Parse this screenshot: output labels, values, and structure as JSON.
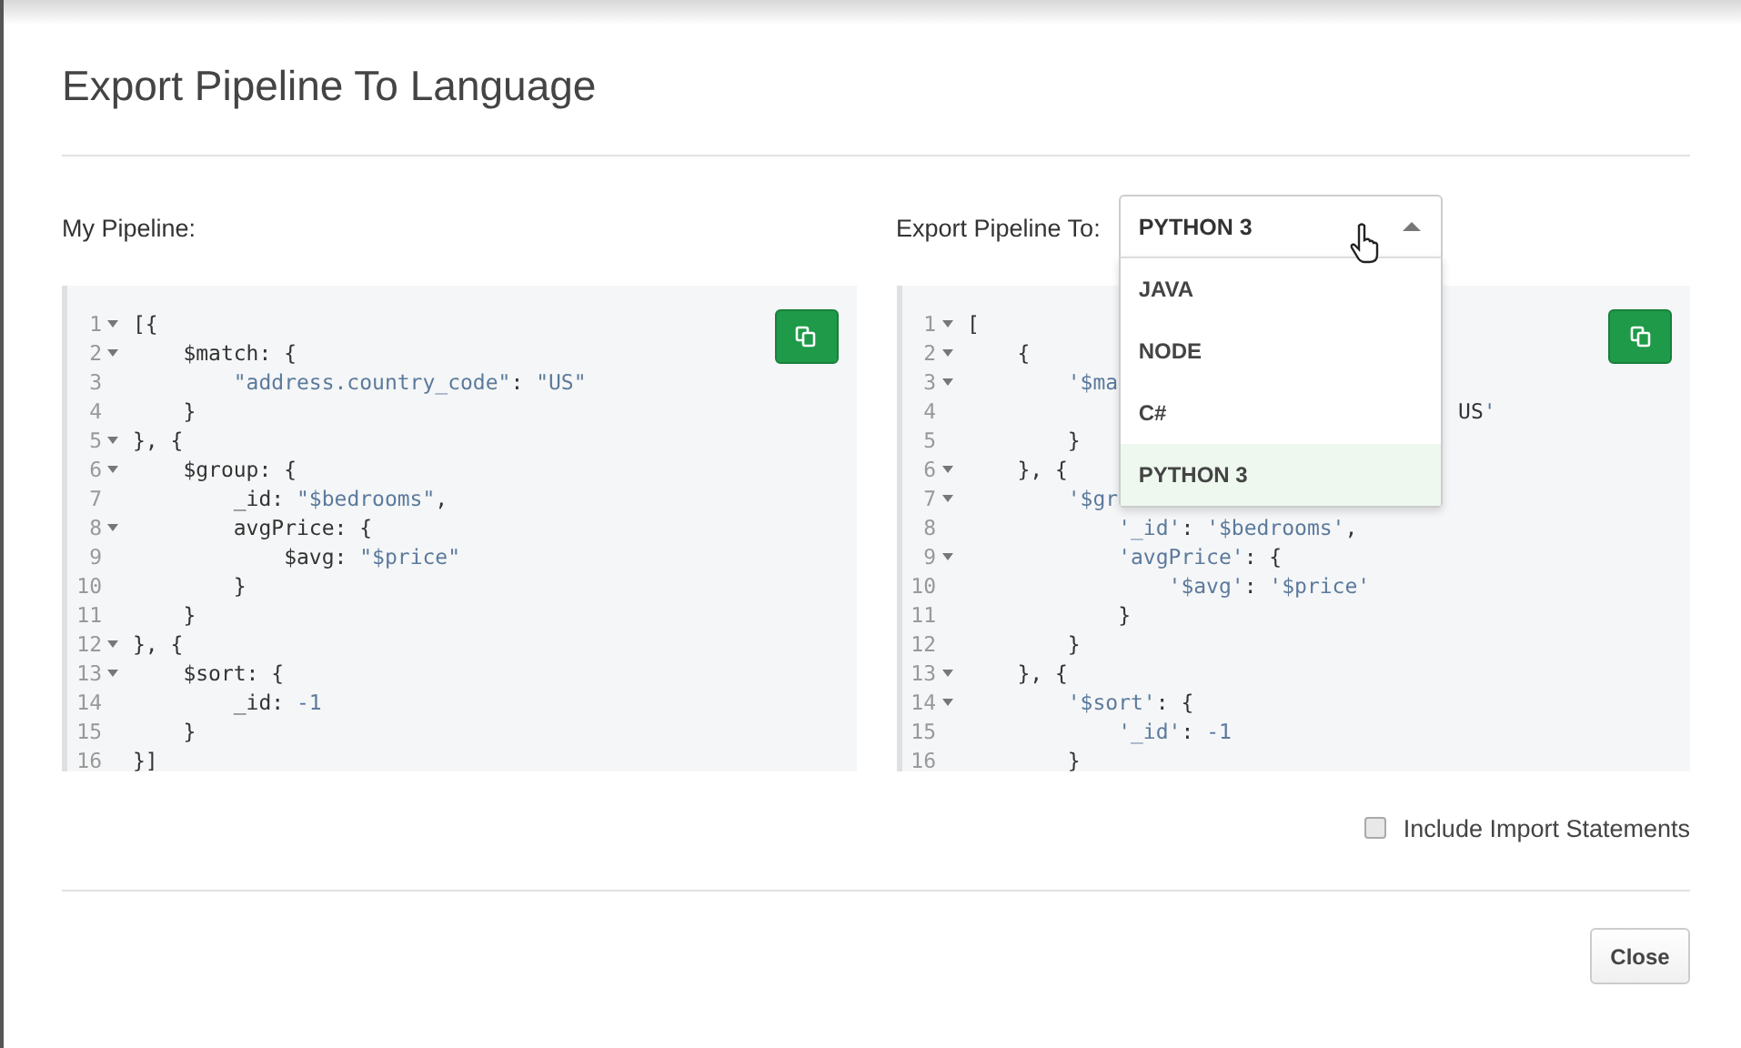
{
  "dialog": {
    "title": "Export Pipeline To Language"
  },
  "source": {
    "label": "My Pipeline:",
    "lines": [
      {
        "number": "1",
        "fold": true,
        "code": "[{"
      },
      {
        "number": "2",
        "fold": true,
        "code": "    $match: {"
      },
      {
        "number": "3",
        "fold": false,
        "code": "        \"address.country_code\": \"US\""
      },
      {
        "number": "4",
        "fold": false,
        "code": "    }"
      },
      {
        "number": "5",
        "fold": true,
        "code": "}, {"
      },
      {
        "number": "6",
        "fold": true,
        "code": "    $group: {"
      },
      {
        "number": "7",
        "fold": false,
        "code": "        _id: \"$bedrooms\","
      },
      {
        "number": "8",
        "fold": true,
        "code": "        avgPrice: {"
      },
      {
        "number": "9",
        "fold": false,
        "code": "            $avg: \"$price\""
      },
      {
        "number": "10",
        "fold": false,
        "code": "        }"
      },
      {
        "number": "11",
        "fold": false,
        "code": "    }"
      },
      {
        "number": "12",
        "fold": true,
        "code": "}, {"
      },
      {
        "number": "13",
        "fold": true,
        "code": "    $sort: {"
      },
      {
        "number": "14",
        "fold": false,
        "code": "        _id: -1"
      },
      {
        "number": "15",
        "fold": false,
        "code": "    }"
      },
      {
        "number": "16",
        "fold": false,
        "code": "}]"
      }
    ]
  },
  "export": {
    "label": "Export Pipeline To:",
    "language": "PYTHON 3",
    "expanded": true,
    "options": [
      {
        "label": "JAVA",
        "selected": false
      },
      {
        "label": "NODE",
        "selected": false
      },
      {
        "label": "C#",
        "selected": false
      },
      {
        "label": "PYTHON 3",
        "selected": true
      }
    ],
    "lines": [
      {
        "number": "1",
        "fold": true,
        "code": "["
      },
      {
        "number": "2",
        "fold": true,
        "code": "    {"
      },
      {
        "number": "3",
        "fold": true,
        "code": "        '$ma"
      },
      {
        "number": "4",
        "fold": false,
        "code": "                                       US'"
      },
      {
        "number": "5",
        "fold": false,
        "code": "        }"
      },
      {
        "number": "6",
        "fold": true,
        "code": "    }, {"
      },
      {
        "number": "7",
        "fold": true,
        "code": "        '$gr"
      },
      {
        "number": "8",
        "fold": false,
        "code": "            '_id': '$bedrooms',"
      },
      {
        "number": "9",
        "fold": true,
        "code": "            'avgPrice': {"
      },
      {
        "number": "10",
        "fold": false,
        "code": "                '$avg': '$price'"
      },
      {
        "number": "11",
        "fold": false,
        "code": "            }"
      },
      {
        "number": "12",
        "fold": false,
        "code": "        }"
      },
      {
        "number": "13",
        "fold": true,
        "code": "    }, {"
      },
      {
        "number": "14",
        "fold": true,
        "code": "        '$sort': {"
      },
      {
        "number": "15",
        "fold": false,
        "code": "            '_id': -1"
      },
      {
        "number": "16",
        "fold": false,
        "code": "        }"
      }
    ]
  },
  "include_imports": {
    "label": "Include Import Statements",
    "checked": false
  },
  "buttons": [
    {
      "label": "Close"
    }
  ]
}
